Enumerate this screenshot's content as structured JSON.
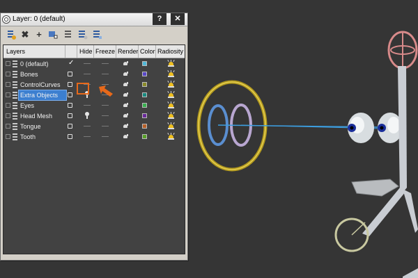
{
  "window": {
    "title": "Layer: 0 (default)",
    "help_label": "?",
    "close_label": "✕"
  },
  "toolbar": {
    "icons": [
      "create-new-layer-icon",
      "delete-layer-icon",
      "add-selection-icon",
      "select-objects-icon",
      "highlight-layer-icon",
      "hide-all-icon",
      "freeze-all-icon"
    ],
    "delete_glyph": "✖",
    "add_glyph": "+"
  },
  "columns": {
    "layers": "Layers",
    "hide": "Hide",
    "freeze": "Freeze",
    "render": "Render",
    "color": "Color",
    "radiosity": "Radiosity"
  },
  "layers": [
    {
      "name": "0 (default)",
      "current": true,
      "hidden": false,
      "color": "#4fb8d8"
    },
    {
      "name": "Bones",
      "current": false,
      "hidden": false,
      "color": "#5a48c8"
    },
    {
      "name": "ControlCurves",
      "current": false,
      "hidden": false,
      "color": "#8a8a2a"
    },
    {
      "name": "Extra Objects",
      "current": false,
      "hidden": true,
      "selected": true,
      "color": "#1a8a80"
    },
    {
      "name": "Eyes",
      "current": false,
      "hidden": false,
      "color": "#3ab050"
    },
    {
      "name": "Head Mesh",
      "current": false,
      "hidden": true,
      "color": "#6a2a9a"
    },
    {
      "name": "Tongue",
      "current": false,
      "hidden": false,
      "color": "#b86028"
    },
    {
      "name": "Tooth",
      "current": false,
      "hidden": false,
      "color": "#58a028"
    }
  ],
  "colors": {
    "highlight": "#e8691a",
    "selection": "#3c7fd0",
    "viewport_bg": "#353535"
  }
}
